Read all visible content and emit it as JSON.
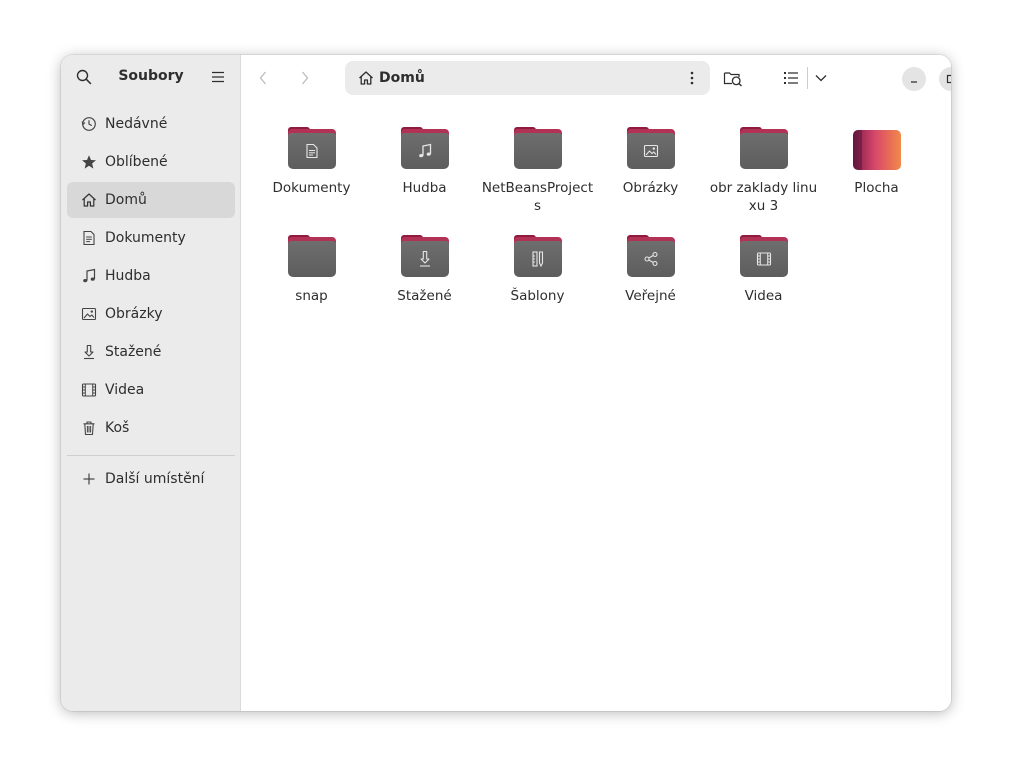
{
  "sidebar": {
    "title": "Soubory",
    "items": [
      {
        "label": "Nedávné",
        "icon": "clock-icon"
      },
      {
        "label": "Oblíbené",
        "icon": "star-icon"
      },
      {
        "label": "Domů",
        "icon": "home-icon",
        "active": true
      },
      {
        "label": "Dokumenty",
        "icon": "document-icon"
      },
      {
        "label": "Hudba",
        "icon": "music-icon"
      },
      {
        "label": "Obrázky",
        "icon": "image-icon"
      },
      {
        "label": "Stažené",
        "icon": "download-icon"
      },
      {
        "label": "Videa",
        "icon": "film-icon"
      },
      {
        "label": "Koš",
        "icon": "trash-icon"
      }
    ],
    "other_locations": "Další umístění"
  },
  "header": {
    "path_label": "Domů"
  },
  "files": [
    {
      "name": "Dokumenty",
      "emblem": "document-icon"
    },
    {
      "name": "Hudba",
      "emblem": "music-icon"
    },
    {
      "name": "NetBeansProjects",
      "emblem": ""
    },
    {
      "name": "Obrázky",
      "emblem": "image-icon"
    },
    {
      "name": "obr zaklady linuxu 3",
      "emblem": ""
    },
    {
      "name": "Plocha",
      "emblem": "desktop"
    },
    {
      "name": "snap",
      "emblem": ""
    },
    {
      "name": "Stažené",
      "emblem": "download-icon"
    },
    {
      "name": "Šablony",
      "emblem": "template-icon"
    },
    {
      "name": "Veřejné",
      "emblem": "share-icon"
    },
    {
      "name": "Videa",
      "emblem": "film-icon"
    }
  ],
  "colors": {
    "accent_folder_tab": "#b23256",
    "folder_body": "#666666",
    "sidebar_bg": "#ebebeb",
    "active_item_bg": "#d8d8d8"
  }
}
